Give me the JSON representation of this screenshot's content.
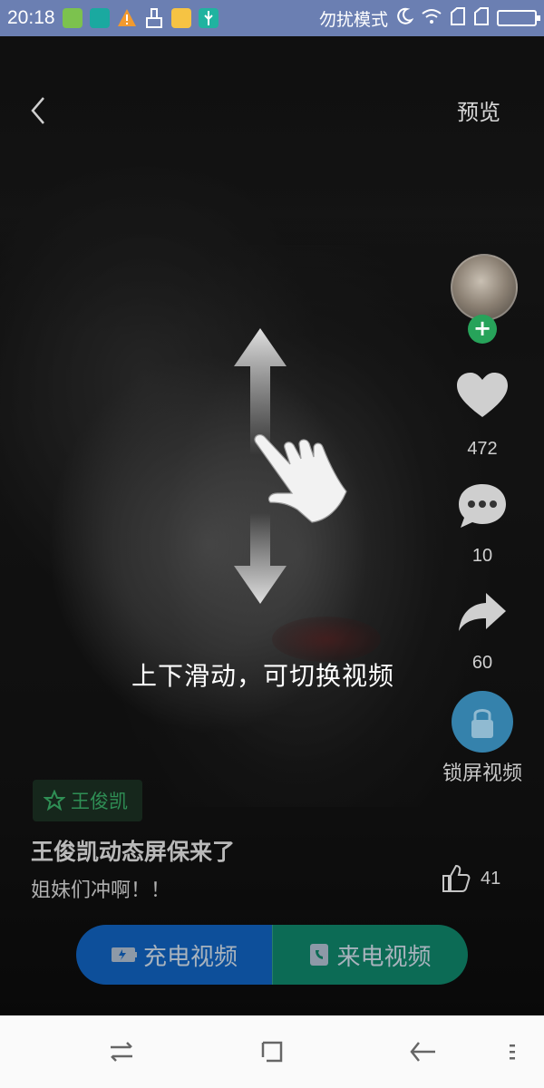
{
  "status_bar": {
    "time": "20:18",
    "app_icons": [
      {
        "name": "android-app-icon",
        "color": "#7cc24e"
      },
      {
        "name": "sync-app-icon",
        "color": "#1aa9a0"
      },
      {
        "name": "warning-app-icon",
        "color": "#f29a2e"
      },
      {
        "name": "cleaner-app-icon",
        "color": "#ffffff"
      },
      {
        "name": "folder-app-icon",
        "color": "#f6c343"
      },
      {
        "name": "usb-app-icon",
        "color": "#20b3a0"
      }
    ],
    "dnd_label": "勿扰模式",
    "background_color": "#6b7fb2"
  },
  "header": {
    "back_icon": "chevron-left-icon",
    "preview_label": "预览"
  },
  "side_actions": {
    "follow_symbol": "+",
    "like_count": "472",
    "comment_count": "10",
    "share_count": "60",
    "lock_screen_label": "锁屏视频"
  },
  "swipe_hint": {
    "text": "上下滑动，可切换视频"
  },
  "video_info": {
    "tag_label": "王俊凯",
    "title": "王俊凯动态屏保来了",
    "subtitle": "姐妹们冲啊！！",
    "thumbs_up_count": "41"
  },
  "action_bar": {
    "charge_video_label": "充电视频",
    "call_video_label": "来电视频",
    "charge_color": "#0d4f9a",
    "call_color": "#0c6b55"
  },
  "nav_bar": {
    "items": [
      "switch-icon",
      "square-icon",
      "back-arrow-icon",
      "menu-icon"
    ]
  }
}
